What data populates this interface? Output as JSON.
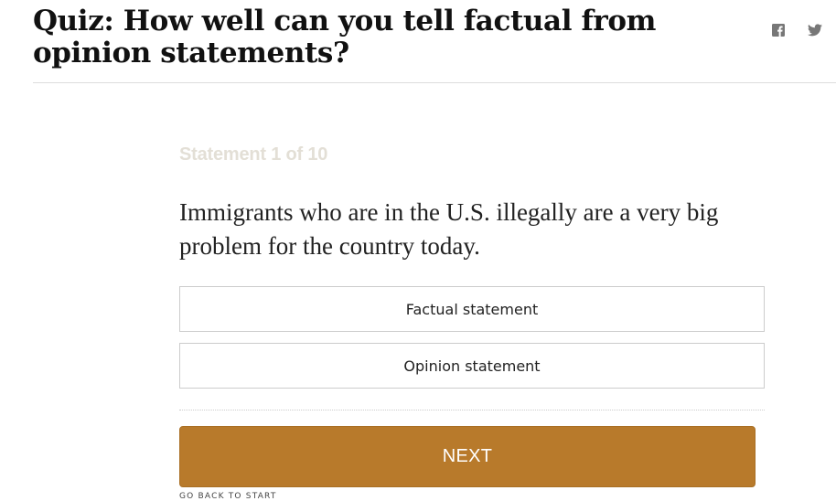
{
  "header": {
    "title": "Quiz: How well can you tell factual from opinion statements?"
  },
  "share": {
    "facebook_icon": "facebook-icon",
    "twitter_icon": "twitter-icon"
  },
  "quiz": {
    "counter": "Statement 1 of 10",
    "statement": "Immigrants who are in the U.S. illegally are a very big problem for the country today.",
    "choices": [
      "Factual statement",
      "Opinion statement"
    ],
    "next_label": "NEXT",
    "back_label": "GO BACK TO START"
  },
  "colors": {
    "accent": "#b87a2b",
    "counter": "#e3dfd6",
    "border": "#cccccc"
  }
}
